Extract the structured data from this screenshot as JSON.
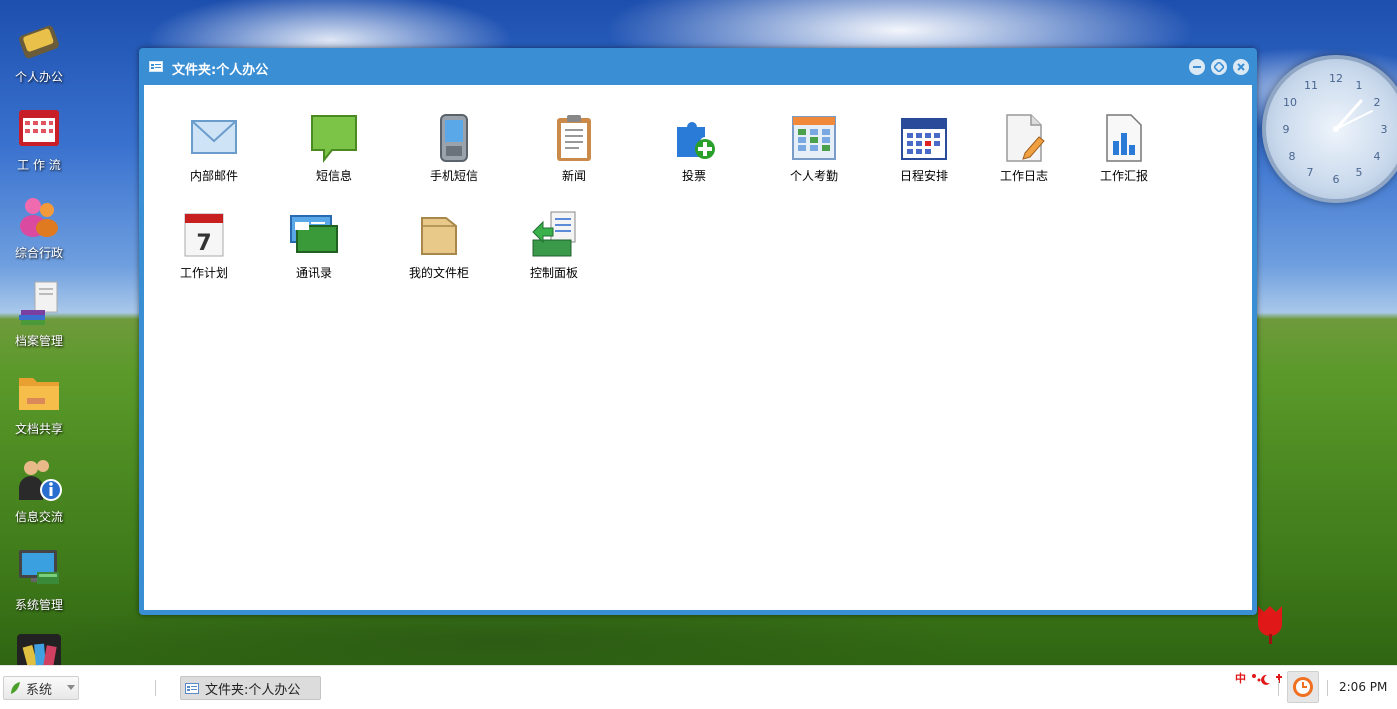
{
  "desktop": {
    "icons": [
      {
        "label": "个人办公",
        "icon": "briefcase-icon"
      },
      {
        "label": "工 作 流",
        "icon": "calendar-grid-icon"
      },
      {
        "label": "综合行政",
        "icon": "users-icon"
      },
      {
        "label": "档案管理",
        "icon": "archive-books-icon"
      },
      {
        "label": "文档共享",
        "icon": "folder-icon"
      },
      {
        "label": "信息交流",
        "icon": "info-people-icon"
      },
      {
        "label": "系统管理",
        "icon": "monitor-icon"
      }
    ]
  },
  "window": {
    "title": "文件夹:个人办公",
    "apps": [
      {
        "label": "内部邮件",
        "icon": "mail-icon"
      },
      {
        "label": "短信息",
        "icon": "speech-bubble-icon"
      },
      {
        "label": "手机短信",
        "icon": "phone-icon"
      },
      {
        "label": "新闻",
        "icon": "clipboard-icon"
      },
      {
        "label": "投票",
        "icon": "puzzle-add-icon"
      },
      {
        "label": "个人考勤",
        "icon": "attendance-grid-icon"
      },
      {
        "label": "日程安排",
        "icon": "calendar-icon"
      },
      {
        "label": "工作日志",
        "icon": "document-edit-icon"
      },
      {
        "label": "工作汇报",
        "icon": "bar-chart-report-icon"
      },
      {
        "label": "工作计划",
        "icon": "date-7-icon"
      },
      {
        "label": "通讯录",
        "icon": "address-cards-icon"
      },
      {
        "label": "我的文件柜",
        "icon": "file-cabinet-icon"
      },
      {
        "label": "控制面板",
        "icon": "control-panel-icon"
      }
    ]
  },
  "clock": {
    "numbers": [
      "12",
      "1",
      "2",
      "3",
      "4",
      "5",
      "6",
      "7",
      "8",
      "9",
      "10",
      "11"
    ]
  },
  "taskbar": {
    "start_label": "系统",
    "task_label": "文件夹:个人办公",
    "time": "2:06 PM"
  },
  "colors": {
    "window_frame": "#3a8fd4",
    "taskbar_bg": "#ffffff"
  }
}
